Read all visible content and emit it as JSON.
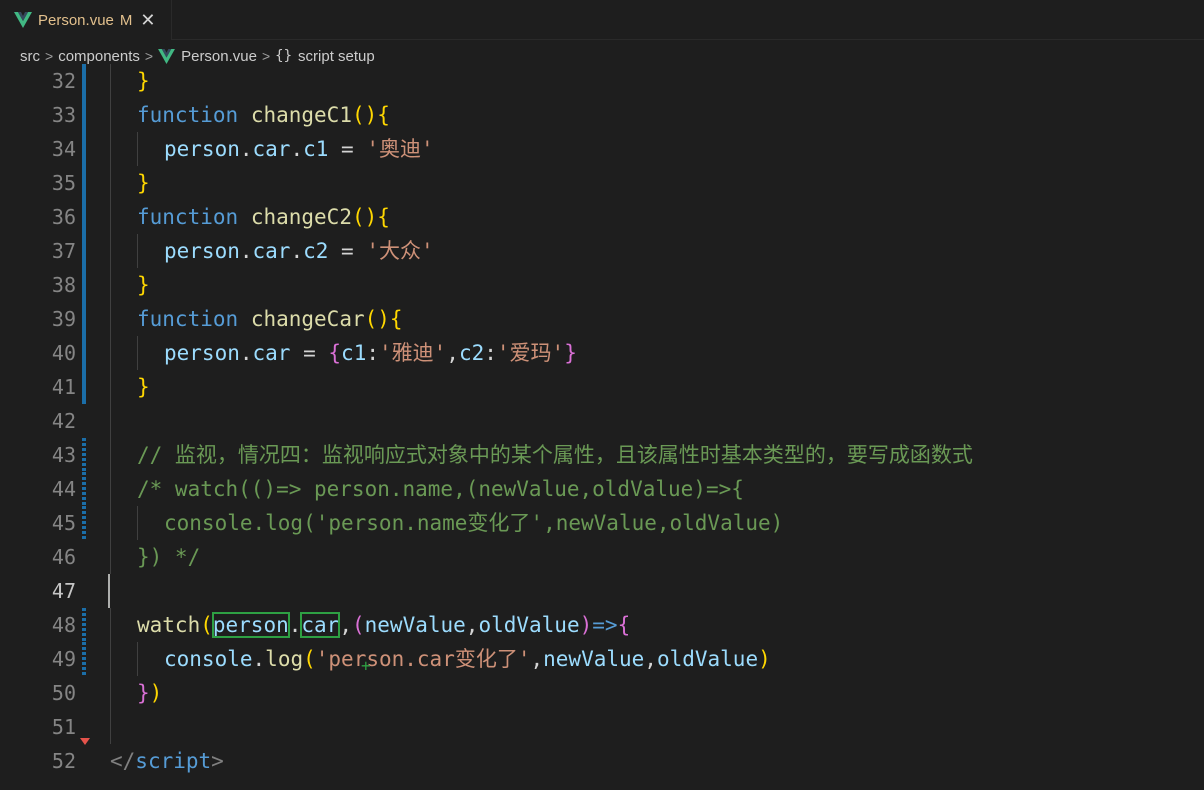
{
  "tab": {
    "filename": "Person.vue",
    "status": "M",
    "close_glyph": "✕"
  },
  "breadcrumb": {
    "items": [
      "src",
      "components",
      "Person.vue",
      "script setup"
    ],
    "braces": "{}",
    "separator": ">"
  },
  "colors": {
    "background": "#1e1e1e",
    "keyword": "#569cd6",
    "function": "#dcdcaa",
    "variable": "#9cdcfe",
    "string": "#ce9178",
    "comment": "#6a9955",
    "highlight_box": "#2ea043",
    "gutter_modified": "#1b6ea8"
  },
  "icons": {
    "vue": "vue-logo-icon"
  },
  "editor": {
    "lines": [
      {
        "num": "32"
      },
      {
        "num": "33"
      },
      {
        "num": "34"
      },
      {
        "num": "35"
      },
      {
        "num": "36"
      },
      {
        "num": "37"
      },
      {
        "num": "38"
      },
      {
        "num": "39"
      },
      {
        "num": "40"
      },
      {
        "num": "41"
      },
      {
        "num": "42"
      },
      {
        "num": "43"
      },
      {
        "num": "44"
      },
      {
        "num": "45"
      },
      {
        "num": "46"
      },
      {
        "num": "47"
      },
      {
        "num": "48"
      },
      {
        "num": "49"
      },
      {
        "num": "50"
      },
      {
        "num": "51"
      },
      {
        "num": "52"
      }
    ],
    "tokens": {
      "l32_brace": "}",
      "l33_kw": "function",
      "l33_fn": "changeC1",
      "l33_parens": "()",
      "l33_brace": "{",
      "l34_var": "person",
      "l34_dot1": ".",
      "l34_car": "car",
      "l34_dot2": ".",
      "l34_prop": "c1",
      "l34_eq": " = ",
      "l34_str": "'奥迪'",
      "l35_brace": "}",
      "l36_kw": "function",
      "l36_fn": "changeC2",
      "l36_parens": "()",
      "l36_brace": "{",
      "l37_var": "person",
      "l37_dot1": ".",
      "l37_car": "car",
      "l37_dot2": ".",
      "l37_prop": "c2",
      "l37_eq": " = ",
      "l37_str": "'大众'",
      "l38_brace": "}",
      "l39_kw": "function",
      "l39_fn": "changeCar",
      "l39_parens": "()",
      "l39_brace": "{",
      "l40_var": "person",
      "l40_dot": ".",
      "l40_car": "car",
      "l40_eq": " = ",
      "l40_ob": "{",
      "l40_k1": "c1",
      "l40_colon1": ":",
      "l40_s1": "'雅迪'",
      "l40_comma": ",",
      "l40_k2": "c2",
      "l40_colon2": ":",
      "l40_s2": "'爱玛'",
      "l40_cb": "}",
      "l41_brace": "}",
      "l43_comment": "// 监视，情况四：监视响应式对象中的某个属性，且该属性时基本类型的，要写成函数式",
      "l44_comment": "/* watch(()=> person.name,(newValue,oldValue)=>{",
      "l45_comment": "console.log('person.name变化了',newValue,oldValue)",
      "l46_comment": "}) */",
      "l48_fn": "watch",
      "l48_p1": "(",
      "l48_person": "person",
      "l48_dot": ".",
      "l48_car": "car",
      "l48_comma1": ",",
      "l48_p2": "(",
      "l48_nv": "newValue",
      "l48_comma2": ",",
      "l48_ov": "oldValue",
      "l48_p3": ")",
      "l48_arrow": "=>",
      "l48_brace": "{",
      "l49_console": "console",
      "l49_dot": ".",
      "l49_log": "log",
      "l49_p1": "(",
      "l49_str": "'person.car变化了'",
      "l49_comma1": ",",
      "l49_nv": "newValue",
      "l49_comma2": ",",
      "l49_ov": "oldValue",
      "l49_p2": ")",
      "l50_brace": "}",
      "l50_paren": ")",
      "l52_lt": "</",
      "l52_tag": "script",
      "l52_gt": ">"
    },
    "plus_glyph": "+"
  }
}
